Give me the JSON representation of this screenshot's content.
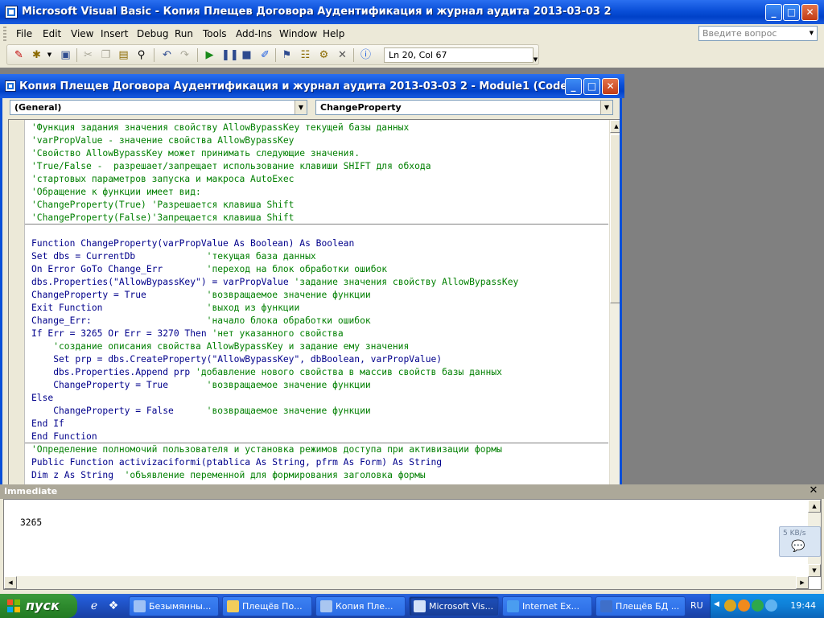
{
  "window": {
    "title": "Microsoft Visual Basic - Копия Плещев Договора Аудентификация и журнал аудита 2013-03-03 2"
  },
  "menu": [
    "File",
    "Edit",
    "View",
    "Insert",
    "Debug",
    "Run",
    "Tools",
    "Add-Ins",
    "Window",
    "Help"
  ],
  "help_box": {
    "placeholder": "Введите вопрос"
  },
  "toolbar": {
    "position": "Ln 20, Col 67"
  },
  "code_window": {
    "title": "Копия Плещев Договора Аудентификация и журнал аудита 2013-03-03 2 - Module1 (Code)",
    "object_combo": "(General)",
    "proc_combo": "ChangeProperty"
  },
  "code_lines": [
    {
      "type": "cm",
      "text": "'Функция задания значения свойству AllowBypassKey текущей базы данных"
    },
    {
      "type": "cm",
      "text": "'varPropValue - значение свойства AllowBypassKey"
    },
    {
      "type": "cm",
      "text": "'Свойство AllowBypassKey может принимать следующие значения."
    },
    {
      "type": "cm",
      "text": "'True/False -  разрешает/запрещает использование клавиши SHIFT для обхода"
    },
    {
      "type": "cm",
      "text": "'стартовых параметров запуска и макроса AutoExec"
    },
    {
      "type": "cm",
      "text": "'Обращение к функции имеет вид:"
    },
    {
      "type": "cm",
      "text": "'ChangeProperty(True) 'Разрешается клавиша Shift"
    },
    {
      "type": "cm",
      "text": "'ChangeProperty(False)'Запрещается клавиша Shift"
    },
    {
      "type": "pl",
      "text": ""
    },
    {
      "type": "kw",
      "text": "Function ChangeProperty(varPropValue As Boolean) As Boolean"
    },
    {
      "type": "mix",
      "code": "Set dbs = CurrentDb             ",
      "comment": "'текущая база данных"
    },
    {
      "type": "mix",
      "code": "On Error GoTo Change_Err        ",
      "comment": "'переход на блок обработки ошибок"
    },
    {
      "type": "mix",
      "code": "dbs.Properties(\"AllowBypassKey\") = varPropValue ",
      "comment": "'задание значения свойству AllowBypassKey"
    },
    {
      "type": "mix",
      "code": "ChangeProperty = True           ",
      "comment": "'возвращаемое значение функции"
    },
    {
      "type": "mix",
      "code": "Exit Function                   ",
      "comment": "'выход из функции"
    },
    {
      "type": "mix",
      "code": "Change_Err:                     ",
      "comment": "'начало блока обработки ошибок"
    },
    {
      "type": "mix",
      "code": "If Err = 3265 Or Err = 3270 Then ",
      "comment": "'нет указанного свойства"
    },
    {
      "type": "cm",
      "text": "    'создание описания свойства AllowBypassKey и задание ему значения"
    },
    {
      "type": "kw",
      "text": "    Set prp = dbs.CreateProperty(\"AllowBypassKey\", dbBoolean, varPropValue)"
    },
    {
      "type": "mix",
      "code": "    dbs.Properties.Append prp ",
      "comment": "'добавление нового свойства в массив свойств базы данных"
    },
    {
      "type": "mix",
      "code": "    ChangeProperty = True       ",
      "comment": "'возвращаемое значение функции"
    },
    {
      "type": "kw",
      "text": "Else"
    },
    {
      "type": "mix",
      "code": "    ChangeProperty = False      ",
      "comment": "'возвращаемое значение функции"
    },
    {
      "type": "kw",
      "text": "End If"
    },
    {
      "type": "kw",
      "text": "End Function"
    },
    {
      "type": "cm",
      "text": "'Определение полномочий пользователя и установка режимов доступа при активизации формы"
    },
    {
      "type": "kw",
      "text": "Public Function activizaciformi(ptablica As String, pfrm As Form) As String"
    },
    {
      "type": "mix",
      "code": "Dim z As String  ",
      "comment": "'объявление переменной для формирования заголовка формы"
    }
  ],
  "immediate": {
    "title": "Immediate",
    "output": "3265"
  },
  "net_widget": {
    "speed": "5 KB/s"
  },
  "taskbar": {
    "start": "пуск",
    "tasks": [
      "Безымянны...",
      "Плещёв По...",
      "Копия Пле...",
      "Microsoft Vis...",
      "Internet Ex...",
      "Плещёв БД ..."
    ],
    "lang": "RU",
    "clock": "19:44"
  }
}
